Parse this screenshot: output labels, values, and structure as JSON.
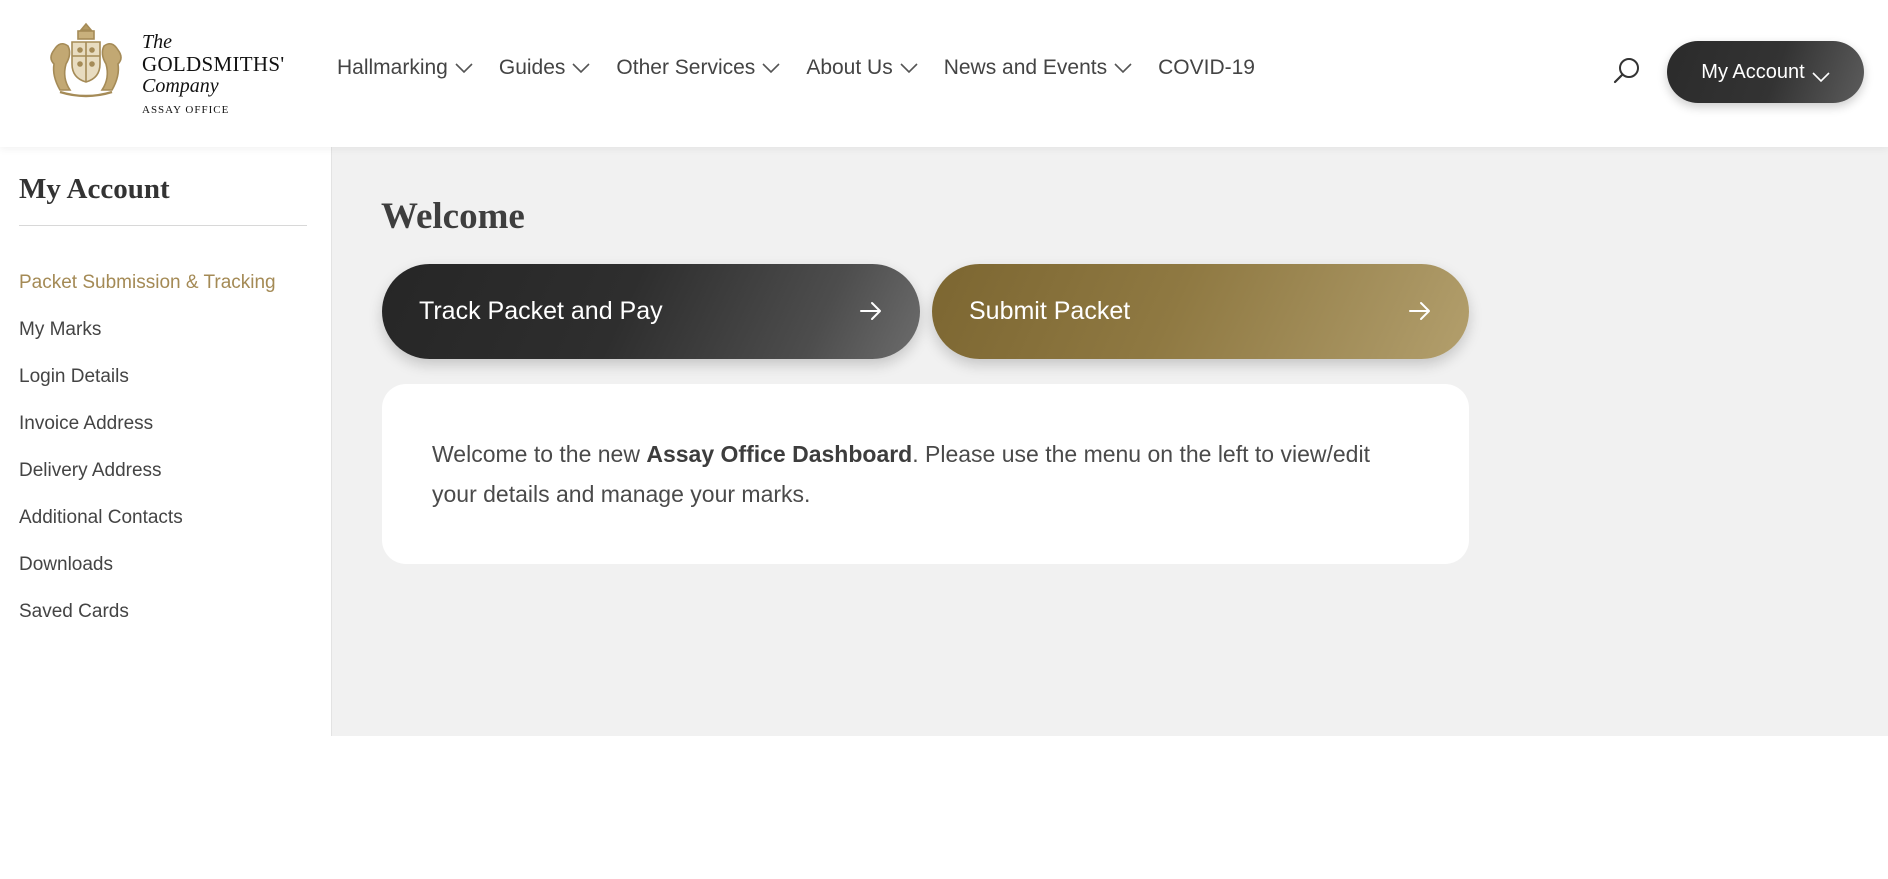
{
  "logo": {
    "line1": "The",
    "line2": "GOLDSMITHS'",
    "line3": "Company",
    "line4": "ASSAY OFFICE"
  },
  "nav": {
    "items": [
      {
        "label": "Hallmarking",
        "has_dropdown": true
      },
      {
        "label": "Guides",
        "has_dropdown": true
      },
      {
        "label": "Other Services",
        "has_dropdown": true
      },
      {
        "label": "About Us",
        "has_dropdown": true
      },
      {
        "label": "News and Events",
        "has_dropdown": true
      },
      {
        "label": "COVID-19",
        "has_dropdown": false
      }
    ],
    "search_icon": "search-icon",
    "account_label": "My Account"
  },
  "sidebar": {
    "title": "My Account",
    "items": [
      {
        "label": "Packet Submission & Tracking",
        "active": true
      },
      {
        "label": "My Marks"
      },
      {
        "label": "Login Details"
      },
      {
        "label": "Invoice Address"
      },
      {
        "label": "Delivery Address"
      },
      {
        "label": "Additional Contacts"
      },
      {
        "label": "Downloads"
      },
      {
        "label": "Saved Cards"
      }
    ]
  },
  "main": {
    "heading": "Welcome",
    "track_button": "Track Packet and Pay",
    "submit_button": "Submit Packet",
    "message_before": "Welcome to the new ",
    "message_bold": "Assay Office Dashboard",
    "message_after": ". Please use the menu on the left to view/edit your details and manage your marks."
  },
  "colors": {
    "accent_gold": "#a48a55",
    "dark_button": "#2b2b2b",
    "gold_button": "#8f7942",
    "content_bg": "#f1f1f1"
  }
}
